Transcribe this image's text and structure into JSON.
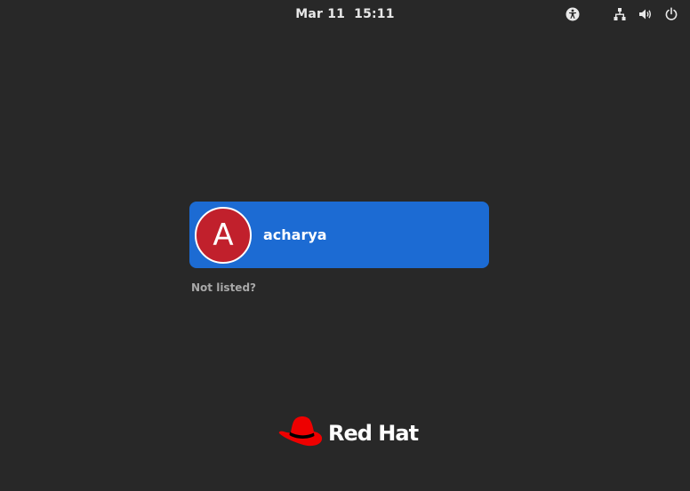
{
  "top_bar": {
    "date": "Mar 11",
    "time": "15:11",
    "icons": {
      "accessibility": "accessibility-icon",
      "network": "network-icon",
      "volume": "volume-icon",
      "power": "power-icon"
    }
  },
  "users": [
    {
      "avatar_letter": "A",
      "name": "acharya"
    }
  ],
  "not_listed_label": "Not listed?",
  "brand": {
    "name": "Red Hat",
    "logo": "red-hat-logo"
  },
  "colors": {
    "background": "#282828",
    "selected_user": "#1c6bd3",
    "avatar": "#c1202c",
    "brand_red": "#ee0000"
  }
}
